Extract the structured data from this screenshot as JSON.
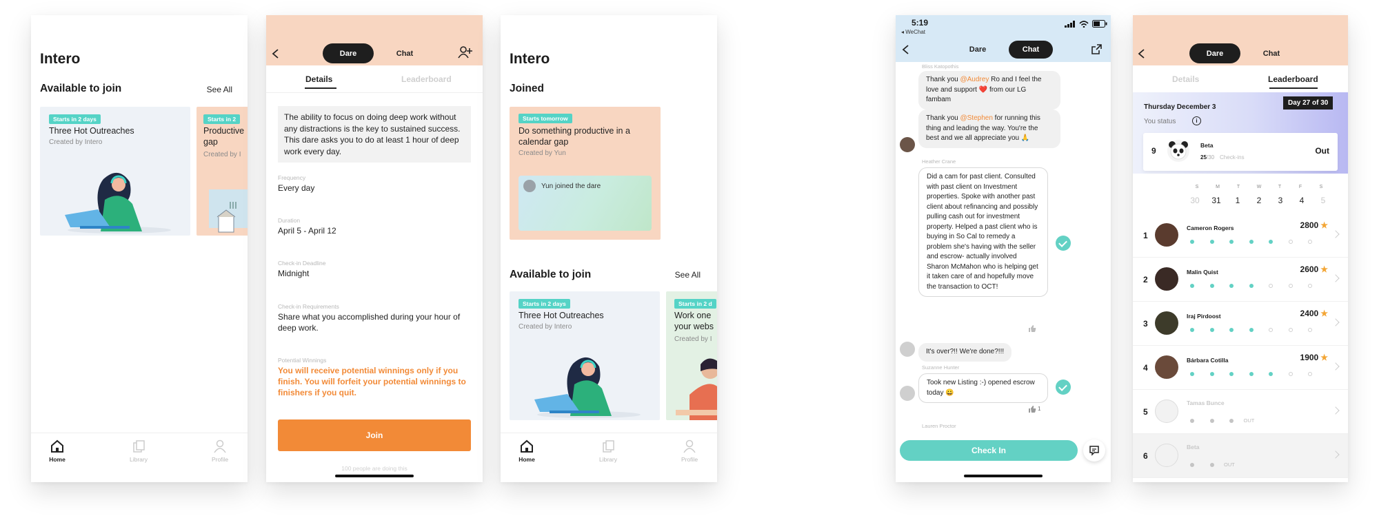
{
  "screen1": {
    "title": "Intero",
    "section": "Available to join",
    "see_all": "See All",
    "cards": [
      {
        "badge": "Starts in 2 days",
        "title": "Three Hot Outreaches",
        "sub": "Created by Intero"
      },
      {
        "badge": "Starts in 2",
        "title": "Productive gap",
        "sub": "Created by I"
      }
    ]
  },
  "tabbar": {
    "home": "Home",
    "library": "Library",
    "profile": "Profile"
  },
  "screen2": {
    "pill_dare": "Dare",
    "pill_chat": "Chat",
    "tab_details": "Details",
    "tab_leaderboard": "Leaderboard",
    "description": "The ability to focus on doing deep work without any distractions is the key to sustained success. This dare asks you to do at least 1 hour of deep work every day.",
    "frequency_label": "Frequency",
    "frequency": "Every day",
    "duration_label": "Duration",
    "duration": "April 5 - April 12",
    "deadline_label": "Check-in Deadline",
    "deadline": "Midnight",
    "requirements_label": "Check-in Requirements",
    "requirements": "Share what you accomplished during your hour of deep work.",
    "winnings_label": "Potential Winnings",
    "winnings": "You will receive potential winnings only if you finish. You will forfeit your potential winnings to finishers if you quit.",
    "join": "Join",
    "footer": "100 people are doing this"
  },
  "screen3": {
    "title": "Intero",
    "joined": "Joined",
    "joined_card": {
      "badge": "Starts tomorrow",
      "title": "Do something productive in a calendar gap",
      "sub": "Created by Yun",
      "notice": "Yun joined the dare"
    },
    "section": "Available to join",
    "see_all": "See All",
    "cards": [
      {
        "badge": "Starts in 2 days",
        "title": "Three Hot Outreaches",
        "sub": "Created by Intero"
      },
      {
        "badge": "Starts in 2 d",
        "title": "Work one your webs",
        "sub": "Created by I"
      }
    ]
  },
  "screen4": {
    "time": "5:19",
    "back_app": "◂ WeChat",
    "pill_dare": "Dare",
    "pill_chat": "Chat",
    "messages": [
      {
        "sender": "Bliss Katopothis",
        "parts": [
          "Thank you ",
          "@Audrey",
          " Ro and I feel the love and support ❤️ from our LG fambam"
        ]
      },
      {
        "sender": "",
        "parts": [
          "Thank you ",
          "@Stephen",
          " for running this thing and leading the way. You're the best and we all appreciate you 🙏"
        ]
      },
      {
        "sender": "Heather Crane",
        "text": "Did a cam for past client. Consulted with past client on Investment properties. Spoke with another past client about refinancing and possibly pulling cash out for investment property. Helped a past client who is buying in So Cal to remedy a problem she's having with the seller and escrow- actually involved Sharon McMahon who is helping get it taken care of and hopefully move the transaction to OCT!"
      },
      {
        "sender": "",
        "text": "It's over?!! We're done?!!!"
      },
      {
        "sender": "Suzanne Hunter",
        "text": "Took new Listing :-) opened escrow today 😀"
      },
      {
        "sender": "Lauren Proctor",
        "text": ""
      }
    ],
    "like_count": "1",
    "check_in": "Check In"
  },
  "screen5": {
    "pill_dare": "Dare",
    "pill_chat": "Chat",
    "tab_details": "Details",
    "tab_leaderboard": "Leaderboard",
    "date": "Thursday December 3",
    "day": "Day 27 of 30",
    "you_status": "You status",
    "me": {
      "rank": "9",
      "name": "Beta",
      "score": "25",
      "of": "/30",
      "checkins": "Check-ins",
      "status": "Out"
    },
    "weekdays": [
      "S",
      "M",
      "T",
      "W",
      "T",
      "F",
      "S"
    ],
    "daynums": [
      "30",
      "31",
      "1",
      "2",
      "3",
      "4",
      "5"
    ],
    "rows": [
      {
        "rank": "1",
        "name": "Cameron Rogers",
        "score": "2800",
        "star": "★",
        "filled": 5,
        "empty": 2,
        "out": ""
      },
      {
        "rank": "2",
        "name": "Malin Quist",
        "score": "2600",
        "star": "★",
        "filled": 4,
        "empty": 3,
        "out": ""
      },
      {
        "rank": "3",
        "name": "Iraj Pirdoost",
        "score": "2400",
        "star": "★",
        "filled": 4,
        "empty": 3,
        "out": ""
      },
      {
        "rank": "4",
        "name": "Bárbara Cotilla",
        "score": "1900",
        "star": "★",
        "filled": 5,
        "empty": 2,
        "out": ""
      },
      {
        "rank": "5",
        "name": "Tamas Bunce",
        "score": "",
        "star": "",
        "filled": 0,
        "grey": 3,
        "empty": 0,
        "out": "OUT"
      },
      {
        "rank": "6",
        "name": "Beta",
        "score": "",
        "star": "",
        "filled": 0,
        "grey": 2,
        "empty": 0,
        "out": "OUT"
      }
    ]
  },
  "colors": {
    "accent_orange": "#f28a37",
    "teal": "#55d3c6",
    "peach": "#f8d6c1",
    "sky": "#d7e9f6",
    "card_blue": "#eef2f7",
    "dark": "#1e1e1e"
  }
}
